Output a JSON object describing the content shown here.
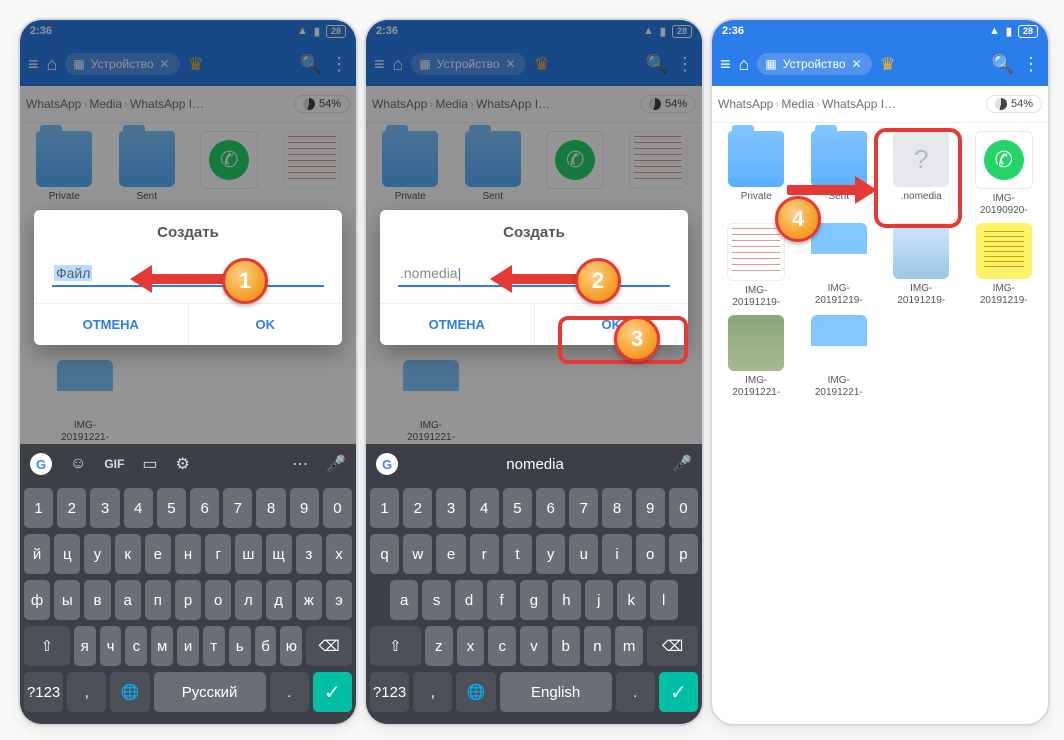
{
  "status": {
    "time": "2:36",
    "battery": "28"
  },
  "nav": {
    "chip": "Устройство"
  },
  "crumbs": {
    "a": "WhatsApp",
    "b": "Media",
    "c": "WhatsApp I…",
    "pct": "54%"
  },
  "files": {
    "private": "Private",
    "sent": "Sent",
    "nomedia": ".nomedia",
    "img0920": "IMG-20190920-",
    "img1219": "IMG-20191219-",
    "img1221": "IMG-20191221-"
  },
  "dialog": {
    "title": "Создать",
    "input1": "Файл",
    "input2": ".nomedia",
    "cancel": "ОТМЕНА",
    "ok": "OK"
  },
  "kb": {
    "nums": [
      "1",
      "2",
      "3",
      "4",
      "5",
      "6",
      "7",
      "8",
      "9",
      "0"
    ],
    "ru1": [
      "й",
      "ц",
      "у",
      "к",
      "е",
      "н",
      "г",
      "ш",
      "щ",
      "з",
      "х"
    ],
    "ru2": [
      "ф",
      "ы",
      "в",
      "а",
      "п",
      "р",
      "о",
      "л",
      "д",
      "ж",
      "э"
    ],
    "ru3": [
      "я",
      "ч",
      "с",
      "м",
      "и",
      "т",
      "ь",
      "б",
      "ю"
    ],
    "en1": [
      "q",
      "w",
      "e",
      "r",
      "t",
      "y",
      "u",
      "i",
      "o",
      "p"
    ],
    "en2": [
      "a",
      "s",
      "d",
      "f",
      "g",
      "h",
      "j",
      "k",
      "l"
    ],
    "en3": [
      "z",
      "x",
      "c",
      "v",
      "b",
      "n",
      "m"
    ],
    "sym": "?123",
    "langRu": "Русский",
    "langEn": "English",
    "dot": ".",
    "suggest": "nomedia",
    "gif": "GIF"
  },
  "steps": {
    "s1": "1",
    "s2": "2",
    "s3": "3",
    "s4": "4"
  }
}
